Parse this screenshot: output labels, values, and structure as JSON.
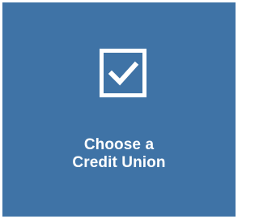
{
  "tile": {
    "label_line1": "Choose a",
    "label_line2": "Credit Union",
    "icon": "checkbox-checked-icon",
    "background_color": "#3f73a6",
    "foreground_color": "#ffffff"
  }
}
